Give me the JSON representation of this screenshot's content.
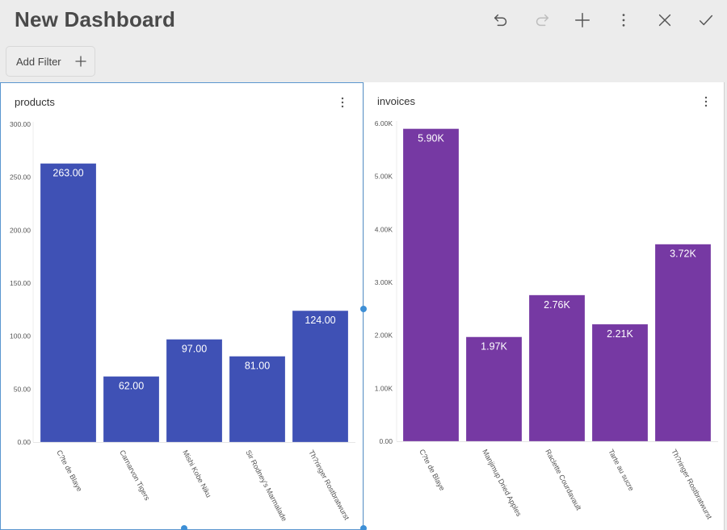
{
  "header": {
    "title": "New Dashboard",
    "toolbar": [
      {
        "name": "undo-button",
        "icon": "undo-icon",
        "enabled": true
      },
      {
        "name": "redo-button",
        "icon": "redo-icon",
        "enabled": false
      },
      {
        "name": "add-button",
        "icon": "plus-icon",
        "enabled": true
      },
      {
        "name": "more-button",
        "icon": "more-vert-icon",
        "enabled": true
      },
      {
        "name": "close-button",
        "icon": "close-icon",
        "enabled": true
      },
      {
        "name": "confirm-button",
        "icon": "check-icon",
        "enabled": true
      }
    ],
    "add_filter_label": "Add Filter"
  },
  "colors": {
    "background": "#ececec",
    "selection": "#3d8fd6",
    "products_bar": "#3f51b5",
    "invoices_bar": "#7639a3"
  },
  "panels": [
    {
      "title": "products",
      "selected": true
    },
    {
      "title": "invoices",
      "selected": false
    }
  ],
  "chart_data": [
    {
      "type": "bar",
      "title": "products",
      "categories": [
        "C?te de Blaye",
        "Carnarvon Tigers",
        "Mishi Kobe Niku",
        "Sir Rodney's Marmalade",
        "Th?ringer Rostbratwurst"
      ],
      "values": [
        263,
        62,
        97,
        81,
        124
      ],
      "data_labels": [
        "263.00",
        "62.00",
        "97.00",
        "81.00",
        "124.00"
      ],
      "yticks": [
        0,
        50,
        100,
        150,
        200,
        250,
        300
      ],
      "ytick_labels": [
        "0.00",
        "50.00",
        "100.00",
        "150.00",
        "200.00",
        "250.00",
        "300.00"
      ],
      "ylim": [
        0,
        300
      ],
      "xlabel": "",
      "ylabel": "",
      "grid": false,
      "color": "#3f51b5"
    },
    {
      "type": "bar",
      "title": "invoices",
      "categories": [
        "C?te de Blaye",
        "Manjimup Dried Apples",
        "Raclette Courdavault",
        "Tarte au sucre",
        "Th?ringer Rostbratwurst"
      ],
      "values": [
        5900,
        1970,
        2760,
        2210,
        3720
      ],
      "data_labels": [
        "5.90K",
        "1.97K",
        "2.76K",
        "2.21K",
        "3.72K"
      ],
      "yticks": [
        0,
        1000,
        2000,
        3000,
        4000,
        5000,
        6000
      ],
      "ytick_labels": [
        "0.00",
        "1.00K",
        "2.00K",
        "3.00K",
        "4.00K",
        "5.00K",
        "6.00K"
      ],
      "ylim": [
        0,
        6000
      ],
      "xlabel": "",
      "ylabel": "",
      "grid": false,
      "color": "#7639a3"
    }
  ]
}
